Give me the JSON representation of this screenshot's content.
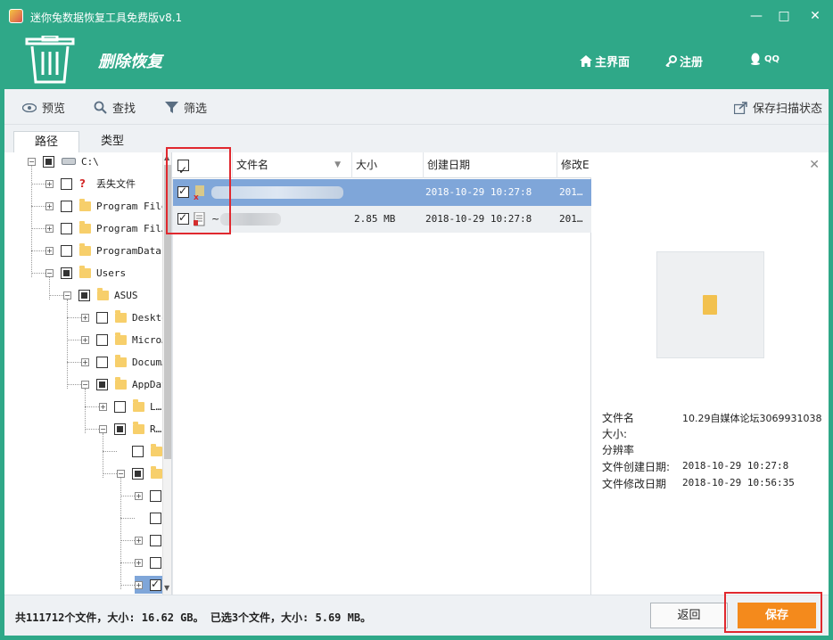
{
  "window": {
    "title": "迷你兔数据恢复工具免费版v8.1",
    "minimize": "—",
    "maximize": "□",
    "close": "✕"
  },
  "header": {
    "heading": "删除恢复",
    "nav": [
      {
        "label": "主界面",
        "icon": "home-icon"
      },
      {
        "label": "注册",
        "icon": "key-icon"
      },
      {
        "label": "QQ",
        "icon": "qq-icon"
      }
    ]
  },
  "toolbar": {
    "preview": "预览",
    "find": "查找",
    "filter": "筛选",
    "save_scan": "保存扫描状态"
  },
  "tabs": [
    "路径",
    "类型"
  ],
  "tree": [
    {
      "label": "C:\\",
      "level": 0,
      "state": "partial",
      "icon": "drive",
      "expander": "−"
    },
    {
      "label": "丢失文件",
      "level": 1,
      "state": "unchecked",
      "icon": "lost",
      "expander": "+"
    },
    {
      "label": "Program Files",
      "level": 1,
      "state": "unchecked",
      "icon": "folder",
      "expander": "+"
    },
    {
      "label": "Program Fil…",
      "level": 1,
      "state": "unchecked",
      "icon": "folder",
      "expander": "+"
    },
    {
      "label": "ProgramData",
      "level": 1,
      "state": "unchecked",
      "icon": "folder",
      "expander": "+"
    },
    {
      "label": "Users",
      "level": 1,
      "state": "partial",
      "icon": "folder",
      "expander": "−"
    },
    {
      "label": "ASUS",
      "level": 2,
      "state": "partial",
      "icon": "folder",
      "expander": "−"
    },
    {
      "label": "Desktop",
      "level": 3,
      "state": "unchecked",
      "icon": "folder",
      "expander": "+"
    },
    {
      "label": "Micro…",
      "level": 3,
      "state": "unchecked",
      "icon": "folder",
      "expander": "+"
    },
    {
      "label": "Docum…",
      "level": 3,
      "state": "unchecked",
      "icon": "folder",
      "expander": "+"
    },
    {
      "label": "AppData",
      "level": 3,
      "state": "partial",
      "icon": "folder",
      "expander": "−"
    },
    {
      "label": "L…",
      "level": 4,
      "state": "unchecked",
      "icon": "folder",
      "expander": "+"
    },
    {
      "label": "R…",
      "level": 4,
      "state": "partial",
      "icon": "folder",
      "expander": "−"
    },
    {
      "label": "",
      "level": 5,
      "state": "unchecked",
      "icon": "folder",
      "expander": ""
    },
    {
      "label": "",
      "level": 5,
      "state": "partial",
      "icon": "folder",
      "expander": "−"
    },
    {
      "label": "",
      "level": 6,
      "state": "unchecked",
      "icon": "folder",
      "expander": "+"
    },
    {
      "label": "",
      "level": 6,
      "state": "unchecked",
      "icon": "folder",
      "expander": ""
    },
    {
      "label": "",
      "level": 6,
      "state": "unchecked",
      "icon": "folder",
      "expander": "+"
    },
    {
      "label": "",
      "level": 6,
      "state": "unchecked",
      "icon": "folder",
      "expander": "+"
    },
    {
      "label": "",
      "level": 6,
      "state": "checked",
      "icon": "folder",
      "expander": "+"
    }
  ],
  "list": {
    "columns": {
      "name": "文件名",
      "size": "大小",
      "created": "创建日期",
      "modified": "修改E"
    },
    "rows": [
      {
        "name": "",
        "size": "",
        "created": "2018-10-29 10:27:8",
        "modified": "201…",
        "checked": true,
        "selected": true
      },
      {
        "name": "~",
        "size": "2.85 MB",
        "created": "2018-10-29 10:27:8",
        "modified": "201…",
        "checked": true,
        "selected": false
      }
    ]
  },
  "preview": {
    "labels": {
      "filename": "文件名",
      "size": "大小:",
      "resolution": "分辨率",
      "created": "文件创建日期:",
      "modified": "文件修改日期"
    },
    "values": {
      "filename": "10.29自媒体论坛3069931038",
      "size": "",
      "resolution": "",
      "created": "2018-10-29 10:27:8",
      "modified": "2018-10-29 10:56:35"
    }
  },
  "status": {
    "summary": "共111712个文件，大小: 16.62 GB。 已选3个文件，大小: 5.69 MB。",
    "back": "返回",
    "save": "保存"
  },
  "colors": {
    "title_bar": "#2fa888",
    "save_button": "#f48a1c",
    "selected_row": "#7fa6d9",
    "highlight_box": "#e0282e"
  }
}
